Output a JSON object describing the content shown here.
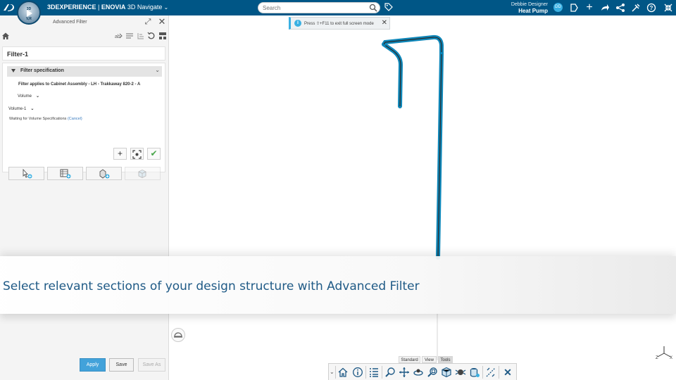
{
  "topbar": {
    "brand_logo": "3DS",
    "compass_top": "3D",
    "compass_bottom": "V,R",
    "brand": "3DEXPERIENCE",
    "separator": " | ",
    "app": "ENOVIA",
    "role": "3D Navigate",
    "search_placeholder": "Search",
    "user_name": "Debbie Designer",
    "collab_space": "Heat Pump",
    "user_initials": "DD",
    "icons": [
      "tag-icon",
      "share-icon",
      "add-icon",
      "forward-icon",
      "network-icon",
      "tools-icon",
      "help-icon",
      "fullscreen-exit-icon"
    ],
    "bg_color": "#005686"
  },
  "panel": {
    "title": "Advanced Filter",
    "filter_name": "Filter-1",
    "spec_header": "Filter specification",
    "applies_to": "Filter applies to Cabinet Assembly - LH - Trakkaway 820-2 - A",
    "type_select": "Volume",
    "volume_select": "Volume-1",
    "waiting_text": "Waiting for Volume Specifications",
    "cancel_link": "(Cancel)",
    "apply_label": "Apply",
    "save_label": "Save",
    "save_as_label": "Save As"
  },
  "viewport": {
    "tip_text": "Press ⇧+F11 to exit full screen mode",
    "axis_labels": [
      "Z",
      "X"
    ]
  },
  "banner": {
    "text": "Select relevant sections of your design structure with Advanced Filter"
  },
  "actionbar": {
    "tabs": [
      "Standard",
      "View",
      "Tools"
    ],
    "active_tab": "Tools",
    "icons": [
      "home-icon",
      "info-icon",
      "tree-icon",
      "zoom-icon",
      "pan-icon",
      "rotate-icon",
      "fit-icon",
      "render-icon",
      "view-icon",
      "explode-icon",
      "measure-icon",
      "section-icon",
      "close-icon"
    ]
  },
  "colors": {
    "accent": "#3ab0e2",
    "banner_text": "#1f5a86",
    "pipe": "#1aa3d9",
    "apply_button": "#42a2da"
  }
}
